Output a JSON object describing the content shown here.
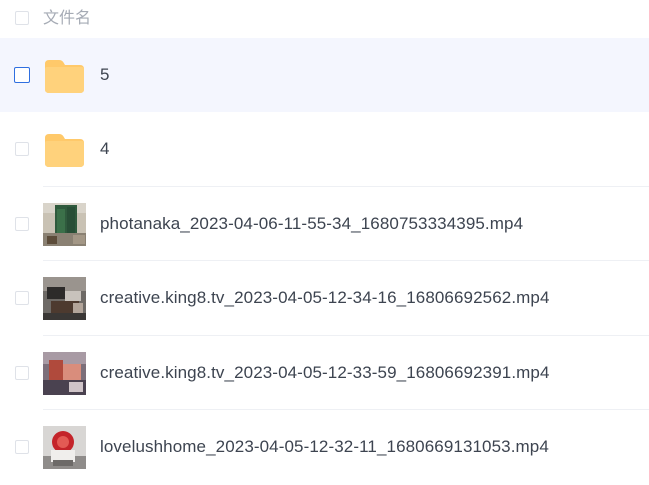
{
  "header": {
    "column_label": "文件名"
  },
  "files": [
    {
      "name": "5",
      "type": "folder",
      "icon": "folder-icon",
      "selected": true
    },
    {
      "name": "4",
      "type": "folder",
      "icon": "folder-icon",
      "selected": false
    },
    {
      "name": "photanaka_2023-04-06-11-55-34_1680753334395.mp4",
      "type": "video",
      "icon": "video-thumbnail",
      "selected": false
    },
    {
      "name": "creative.king8.tv_2023-04-05-12-34-16_16806692562.mp4",
      "type": "video",
      "icon": "video-thumbnail",
      "selected": false
    },
    {
      "name": "creative.king8.tv_2023-04-05-12-33-59_16806692391.mp4",
      "type": "video",
      "icon": "video-thumbnail",
      "selected": false
    },
    {
      "name": "lovelushhome_2023-04-05-12-32-11_1680669131053.mp4",
      "type": "video",
      "icon": "video-thumbnail",
      "selected": false
    }
  ],
  "colors": {
    "selected_row_bg": "#f4f6fe",
    "checkbox_selected_border": "#2f6fe0",
    "folder_body": "#ffc96a",
    "folder_tab": "#ffd98f"
  }
}
